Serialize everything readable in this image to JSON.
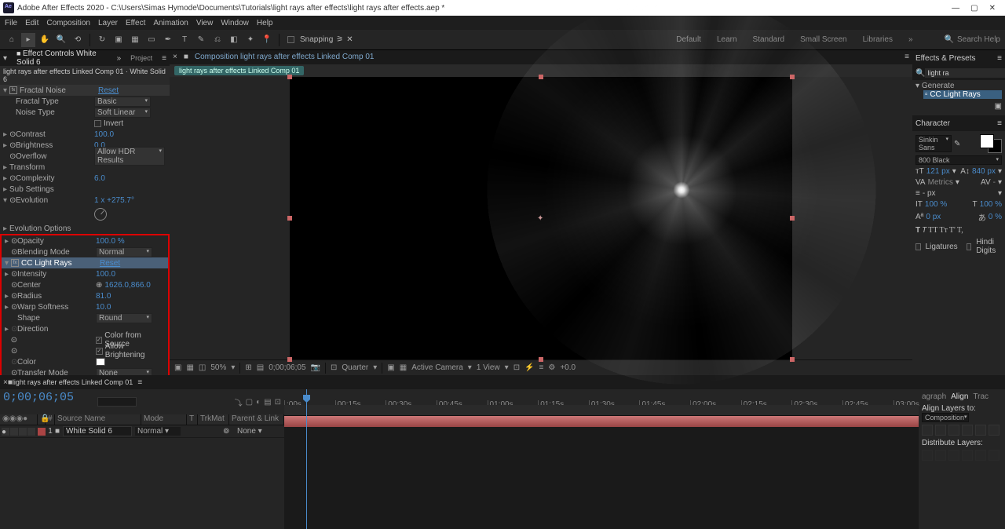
{
  "titlebar": {
    "text": "Adobe After Effects 2020 - C:\\Users\\Simas Hymode\\Documents\\Tutorials\\light rays after effects\\light rays after effects.aep *"
  },
  "menu": [
    "File",
    "Edit",
    "Composition",
    "Layer",
    "Effect",
    "Animation",
    "View",
    "Window",
    "Help"
  ],
  "snapping_label": "Snapping",
  "workspaces": [
    "Default",
    "Learn",
    "Standard",
    "Small Screen",
    "Libraries"
  ],
  "search_help": "Search Help",
  "effect_controls": {
    "tab": "Effect Controls White Solid 6",
    "project_tab": "Project",
    "header": "light rays after effects Linked Comp 01 · White Solid 6",
    "effects": {
      "fractal_noise": {
        "name": "Fractal Noise",
        "reset": "Reset",
        "fractal_type_label": "Fractal Type",
        "fractal_type_value": "Basic",
        "noise_type_label": "Noise Type",
        "noise_type_value": "Soft Linear",
        "invert_label": "Invert",
        "contrast_label": "Contrast",
        "contrast_value": "100.0",
        "brightness_label": "Brightness",
        "brightness_value": "0.0",
        "overflow_label": "Overflow",
        "overflow_value": "Allow HDR Results",
        "transform_label": "Transform",
        "complexity_label": "Complexity",
        "complexity_value": "6.0",
        "sub_settings_label": "Sub Settings",
        "evolution_label": "Evolution",
        "evolution_value": "1 x +275.7°",
        "evolution_options_label": "Evolution Options",
        "opacity_label": "Opacity",
        "opacity_value": "100.0 %",
        "blending_mode_label": "Blending Mode",
        "blending_mode_value": "Normal"
      },
      "cc_light_rays": {
        "name": "CC Light Rays",
        "reset": "Reset",
        "intensity_label": "Intensity",
        "intensity_value": "100.0",
        "center_label": "Center",
        "center_value": "1626.0,866.0",
        "radius_label": "Radius",
        "radius_value": "81.0",
        "warp_softness_label": "Warp Softness",
        "warp_softness_value": "10.0",
        "shape_label": "Shape",
        "shape_value": "Round",
        "direction_label": "Direction",
        "color_from_source_label": "Color from Source",
        "allow_brightening_label": "Allow Brightening",
        "color_label": "Color",
        "transfer_mode_label": "Transfer Mode",
        "transfer_mode_value": "None"
      }
    }
  },
  "composition": {
    "tab_prefix": "Composition",
    "name": "light rays after effects Linked Comp 01",
    "flow_chip": "light rays after effects Linked Comp 01"
  },
  "viewer_toolbar": {
    "zoom": "50%",
    "timecode": "0;00;06;05",
    "quality": "Quarter",
    "camera": "Active Camera",
    "views": "1 View",
    "exposure": "+0.0"
  },
  "effects_presets": {
    "title": "Effects & Presets",
    "search": "light ra",
    "category": "Generate",
    "result": "CC Light Rays"
  },
  "character": {
    "title": "Character",
    "font": "Sinkin Sans",
    "weight": "800 Black",
    "size": "121 px",
    "leading": "840 px",
    "va_value": "Metrics",
    "stroke": "- px",
    "vscale": "100 %",
    "hscale": "100 %",
    "baseline": "0 px",
    "tsume": "0 %",
    "ligatures": "Ligatures",
    "hindi": "Hindi Digits"
  },
  "timeline": {
    "tab": "light rays after effects Linked Comp 01",
    "timecode": "0;00;06;05",
    "ticks": [
      ":00s",
      "00:15s",
      "00:30s",
      "00:45s",
      "01:00s",
      "01:15s",
      "01:30s",
      "01:45s",
      "02:00s",
      "02:15s",
      "02:30s",
      "02:45s",
      "03:00s"
    ],
    "cols": {
      "num": "#",
      "source": "Source Name",
      "mode": "Mode",
      "t": "T",
      "trkmat": "TrkMat",
      "parent": "Parent & Link"
    },
    "layer": {
      "num": "1",
      "name": "White Solid 6",
      "mode": "Normal",
      "parent": "None"
    }
  },
  "align": {
    "tabs": [
      "agraph",
      "Align",
      "Trac"
    ],
    "align_to_label": "Align Layers to:",
    "align_to_value": "Composition",
    "distribute_label": "Distribute Layers:"
  }
}
